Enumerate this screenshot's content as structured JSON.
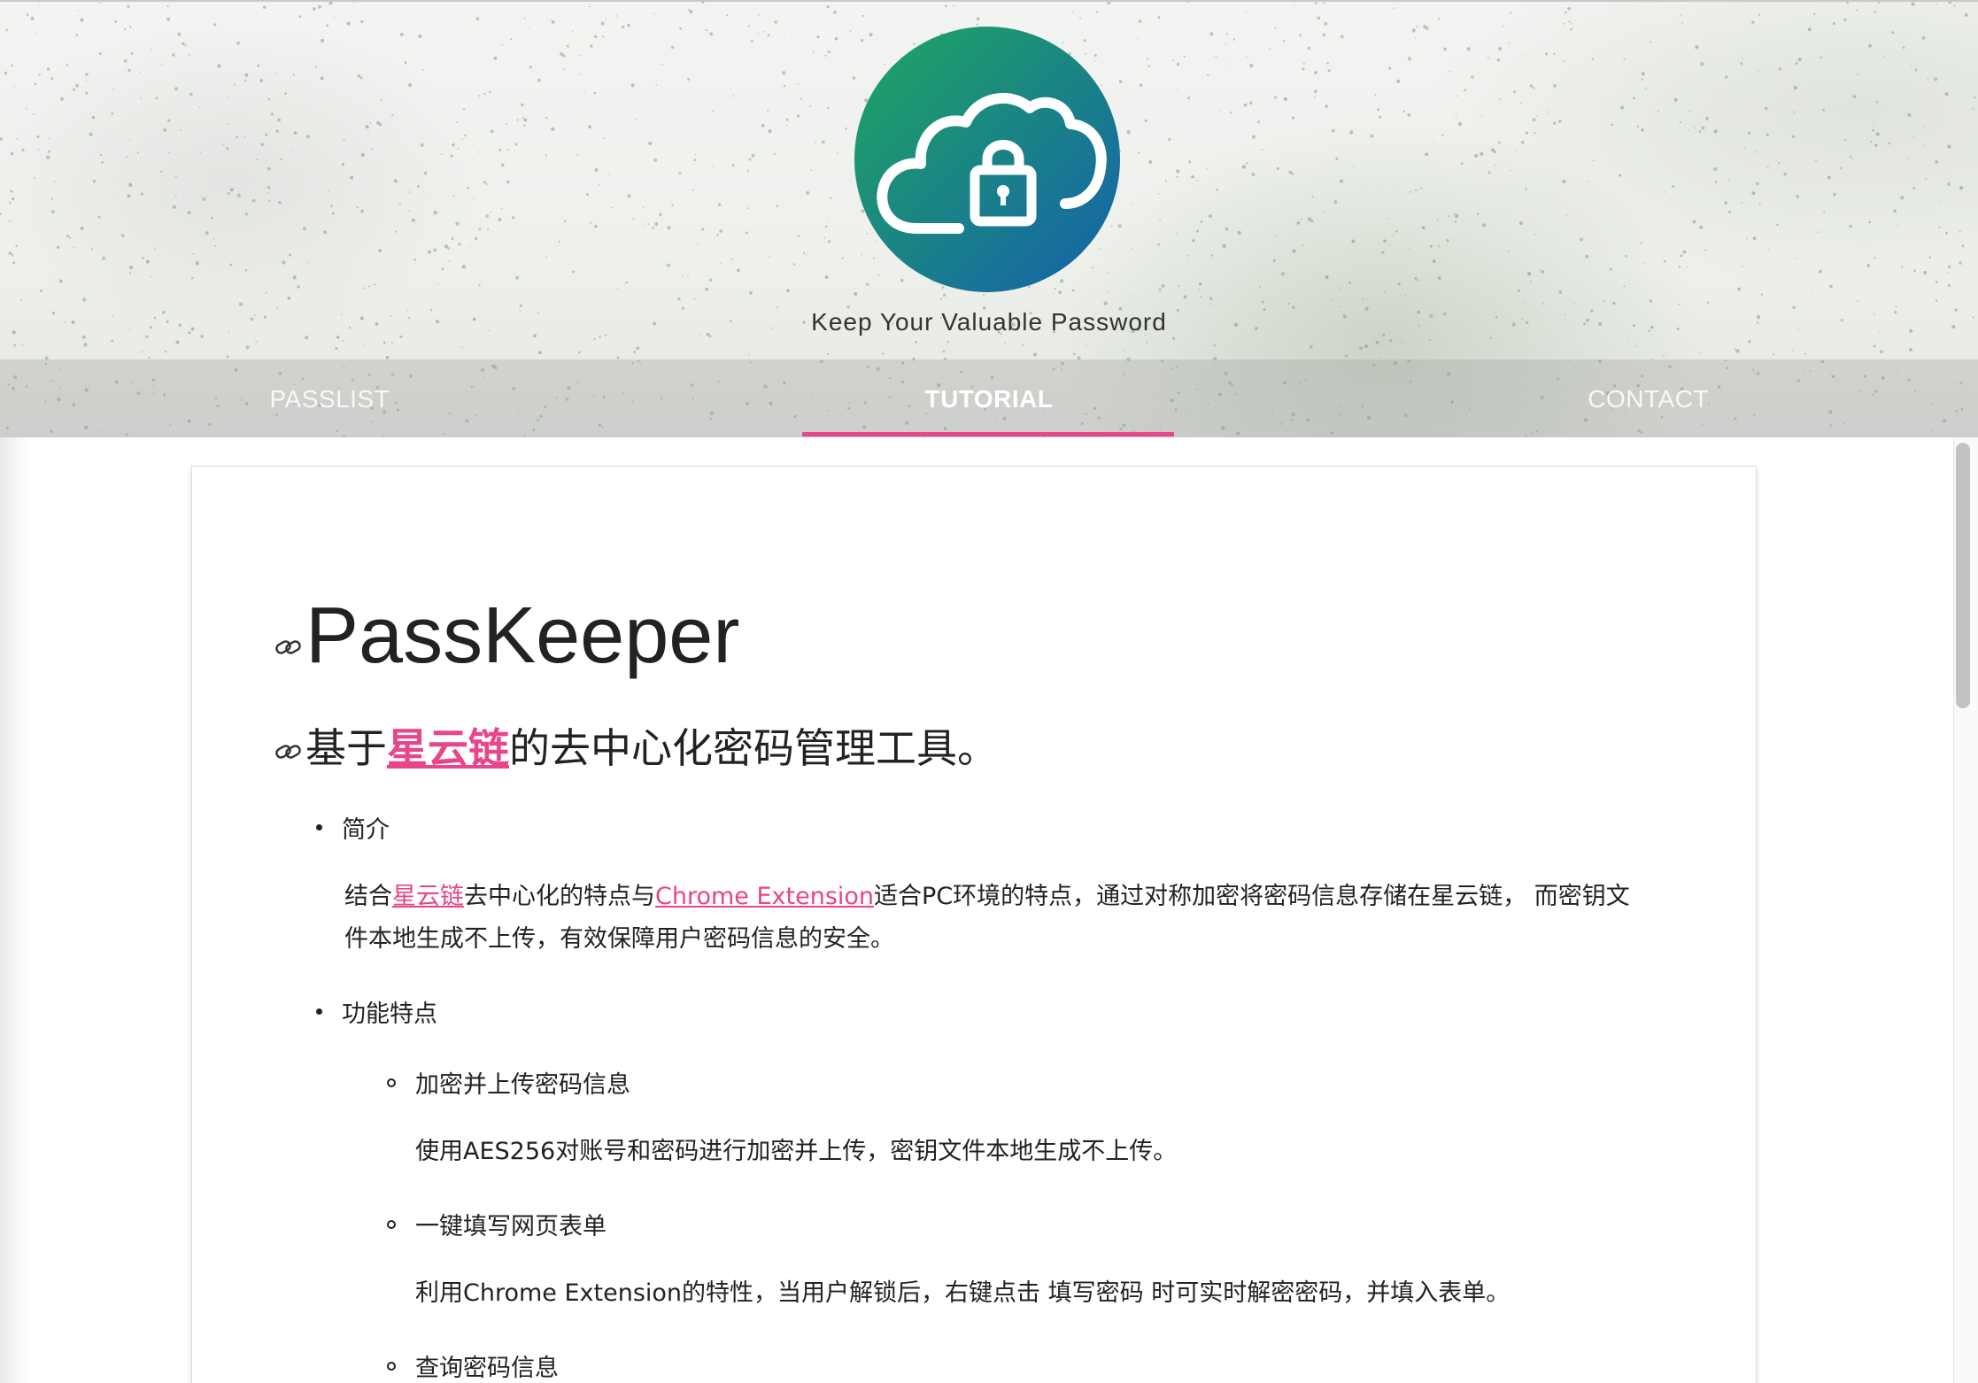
{
  "header": {
    "tagline": "Keep Your Valuable Password",
    "logo_icon": "cloud-lock-icon",
    "nav": [
      {
        "label": "PASSLIST",
        "active": false
      },
      {
        "label": "TUTORIAL",
        "active": true
      },
      {
        "label": "CONTACT",
        "active": false
      }
    ]
  },
  "content": {
    "title": "PassKeeper",
    "subtitle": {
      "before": "基于",
      "link": "星云链",
      "after": "的去中心化密码管理工具。"
    },
    "intro": {
      "heading": "简介",
      "p1_a": "结合",
      "p1_link1": "星云链",
      "p1_b": "去中心化的特点与",
      "p1_link2": "Chrome Extension",
      "p1_c": "适合PC环境的特点，通过对称加密将密码信息存储在星云链， 而密钥文",
      "p2": "件本地生成不上传，有效保障用户密码信息的安全。"
    },
    "features": {
      "heading": "功能特点",
      "items": [
        {
          "title": "加密并上传密码信息",
          "desc": "使用AES256对账号和密码进行加密并上传，密钥文件本地生成不上传。"
        },
        {
          "title": "一键填写网页表单",
          "desc": "利用Chrome Extension的特性，当用户解锁后，右键点击 填写密码 时可实时解密密码，并填入表单。"
        },
        {
          "title": "查询密码信息",
          "desc": ""
        }
      ]
    }
  },
  "colors": {
    "accent": "#e8458a",
    "logo_gradient_start": "#1fa05f",
    "logo_gradient_end": "#1762a8"
  }
}
